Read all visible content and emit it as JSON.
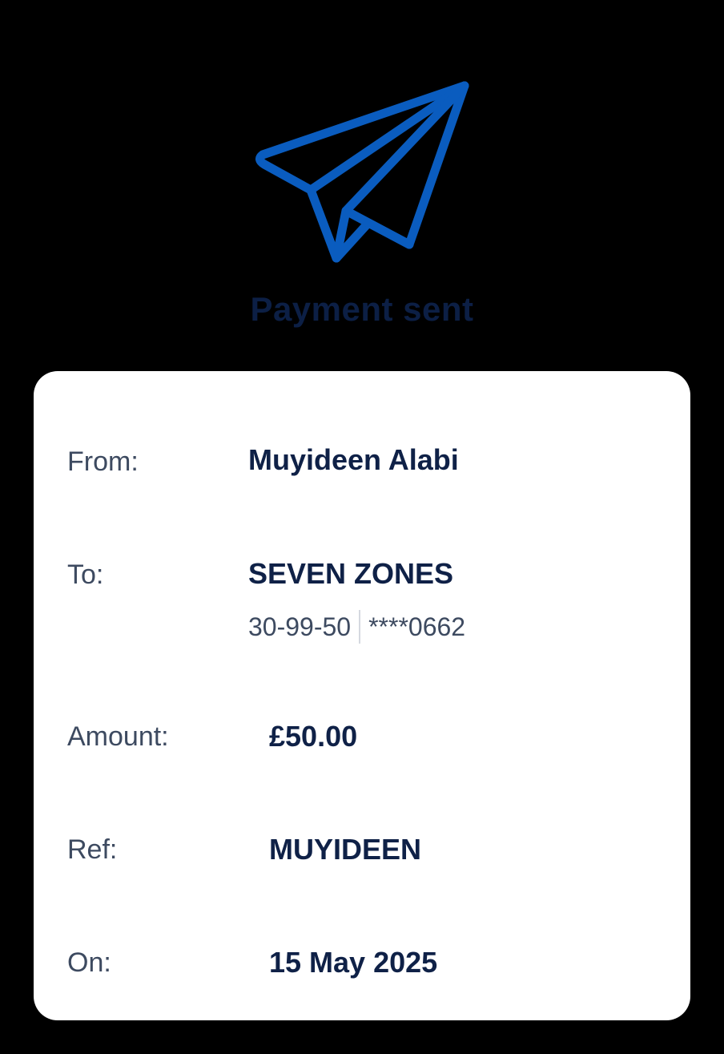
{
  "status": {
    "icon": "paper-plane-icon",
    "title": "Payment sent",
    "accent_color": "#0a5cbf",
    "title_color": "#0c1f45"
  },
  "details": {
    "from": {
      "label": "From:",
      "value": "Muyideen Alabi"
    },
    "to": {
      "label": "To:",
      "value": "SEVEN ZONES",
      "sort_code": "30-99-50",
      "account_number": "****0662"
    },
    "amount": {
      "label": "Amount:",
      "value": "£50.00"
    },
    "ref": {
      "label": "Ref:",
      "value": "MUYIDEEN"
    },
    "on": {
      "label": "On:",
      "value": "15 May 2025"
    }
  }
}
